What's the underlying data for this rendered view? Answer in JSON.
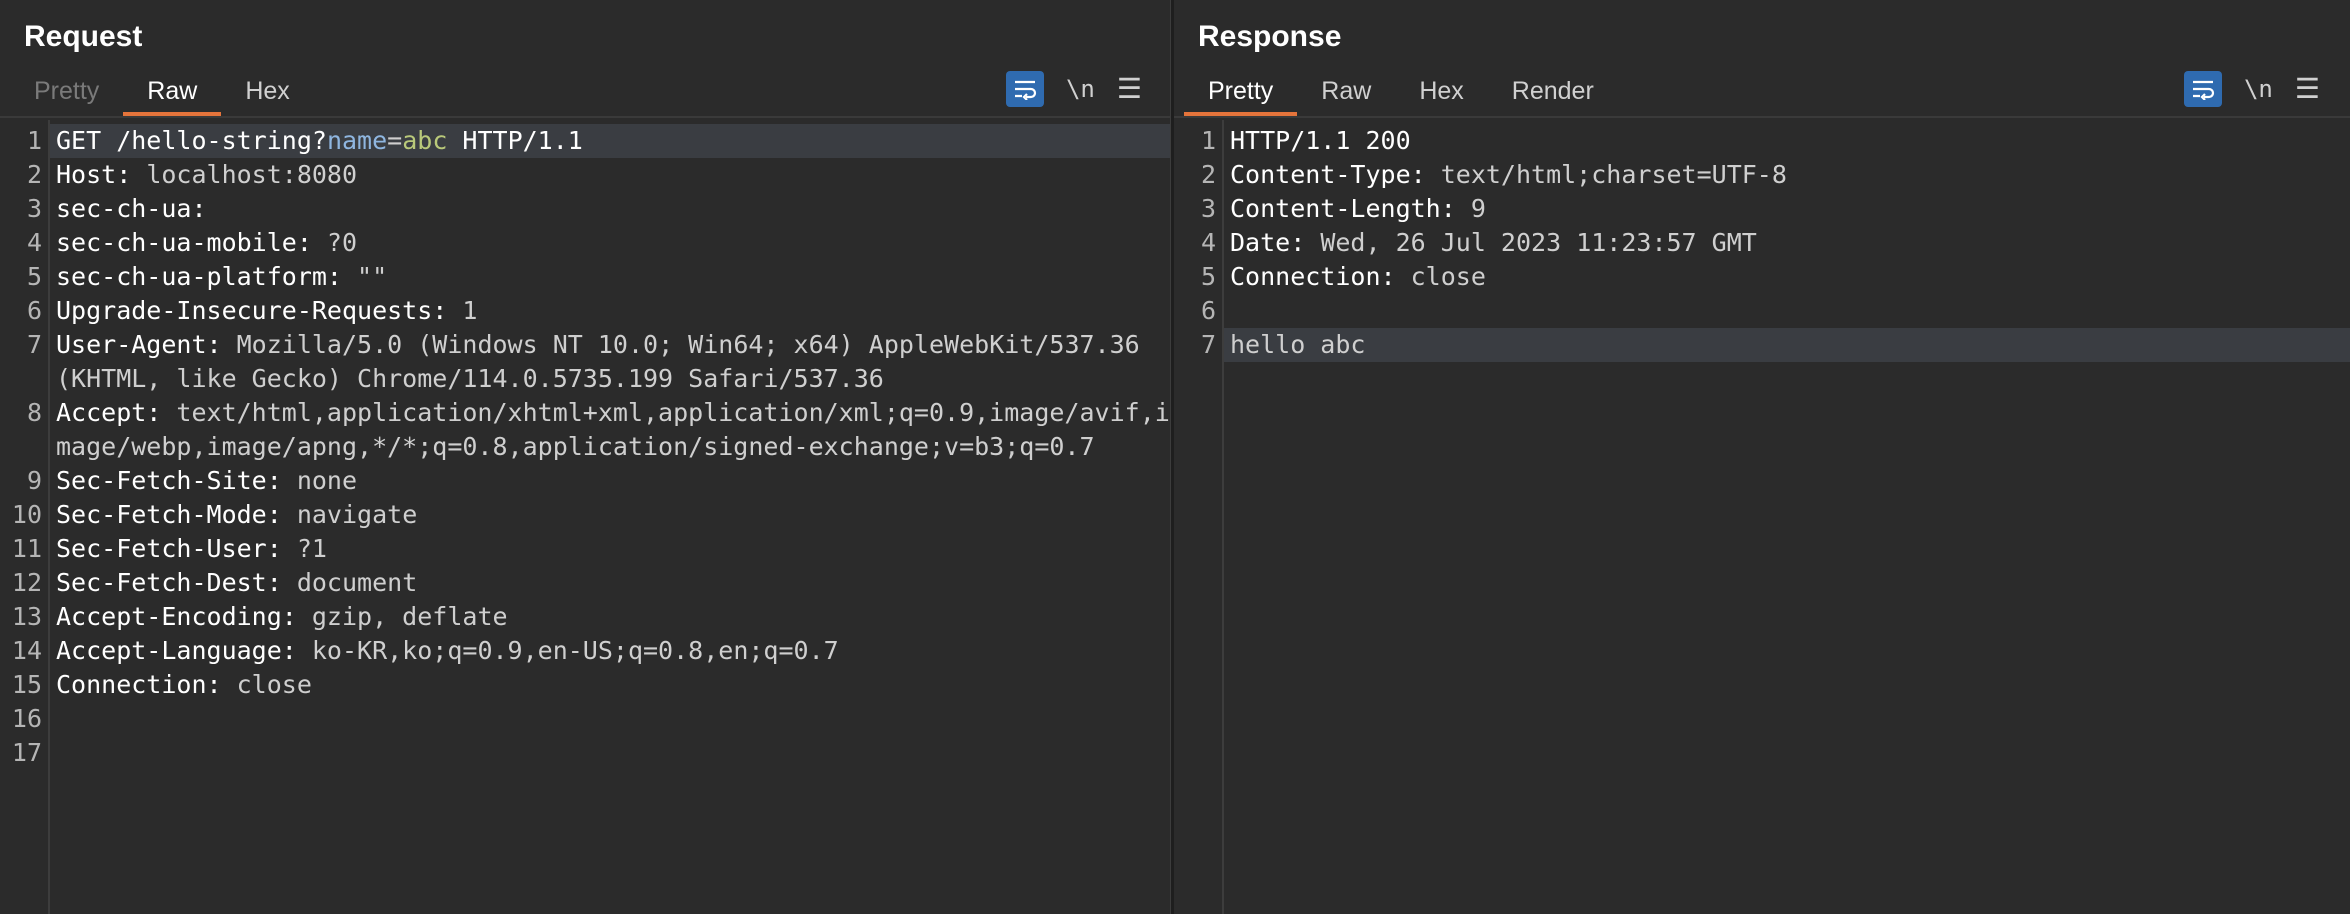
{
  "request": {
    "title": "Request",
    "tabs": [
      {
        "label": "Pretty",
        "state": "disabled"
      },
      {
        "label": "Raw",
        "state": "active"
      },
      {
        "label": "Hex",
        "state": "normal"
      }
    ],
    "newline_label": "\\n",
    "request_line": {
      "method_path": "GET /hello-string?",
      "param_name": "name",
      "equals": "=",
      "param_value": "abc",
      "version": " HTTP/1.1"
    },
    "lines": [
      {
        "n": "1"
      },
      {
        "n": "2",
        "key": "Host:",
        "value": " localhost:8080"
      },
      {
        "n": "3",
        "key": "sec-ch-ua:",
        "value": ""
      },
      {
        "n": "4",
        "key": "sec-ch-ua-mobile:",
        "value": " ?0"
      },
      {
        "n": "5",
        "key": "sec-ch-ua-platform:",
        "value": " \"\""
      },
      {
        "n": "6",
        "key": "Upgrade-Insecure-Requests:",
        "value": " 1"
      },
      {
        "n": "7",
        "key": "User-Agent:",
        "value": " Mozilla/5.0 (Windows NT 10.0; Win64; x64) AppleWebKit/537.36 (KHTML, like Gecko) Chrome/114.0.5735.199 Safari/537.36"
      },
      {
        "n": "8",
        "key": "Accept:",
        "value": " text/html,application/xhtml+xml,application/xml;q=0.9,image/avif,image/webp,image/apng,*/*;q=0.8,application/signed-exchange;v=b3;q=0.7"
      },
      {
        "n": "9",
        "key": "Sec-Fetch-Site:",
        "value": " none"
      },
      {
        "n": "10",
        "key": "Sec-Fetch-Mode:",
        "value": " navigate"
      },
      {
        "n": "11",
        "key": "Sec-Fetch-User:",
        "value": " ?1"
      },
      {
        "n": "12",
        "key": "Sec-Fetch-Dest:",
        "value": " document"
      },
      {
        "n": "13",
        "key": "Accept-Encoding:",
        "value": " gzip, deflate"
      },
      {
        "n": "14",
        "key": "Accept-Language:",
        "value": " ko-KR,ko;q=0.9,en-US;q=0.8,en;q=0.7"
      },
      {
        "n": "15",
        "key": "Connection:",
        "value": " close"
      },
      {
        "n": "16",
        "key": "",
        "value": ""
      },
      {
        "n": "17",
        "key": "",
        "value": ""
      }
    ]
  },
  "response": {
    "title": "Response",
    "tabs": [
      {
        "label": "Pretty",
        "state": "active"
      },
      {
        "label": "Raw",
        "state": "normal"
      },
      {
        "label": "Hex",
        "state": "normal"
      },
      {
        "label": "Render",
        "state": "normal"
      }
    ],
    "newline_label": "\\n",
    "lines": [
      {
        "n": "1",
        "key": "HTTP/1.1 200",
        "value": ""
      },
      {
        "n": "2",
        "key": "Content-Type:",
        "value": " text/html;charset=UTF-8"
      },
      {
        "n": "3",
        "key": "Content-Length:",
        "value": " 9"
      },
      {
        "n": "4",
        "key": "Date:",
        "value": " Wed, 26 Jul 2023 11:23:57 GMT"
      },
      {
        "n": "5",
        "key": "Connection:",
        "value": " close"
      },
      {
        "n": "6",
        "key": "",
        "value": ""
      },
      {
        "n": "7",
        "key": "",
        "value": "hello abc"
      }
    ]
  },
  "icons": {
    "wrap": "word-wrap-icon",
    "menu": "hamburger-menu-icon",
    "layout_side": "split-horizontal-icon",
    "layout_stack": "split-vertical-icon",
    "layout_single": "single-pane-icon"
  },
  "colors": {
    "accent_tab": "#e5743b",
    "active_button": "#2f6bb0"
  }
}
